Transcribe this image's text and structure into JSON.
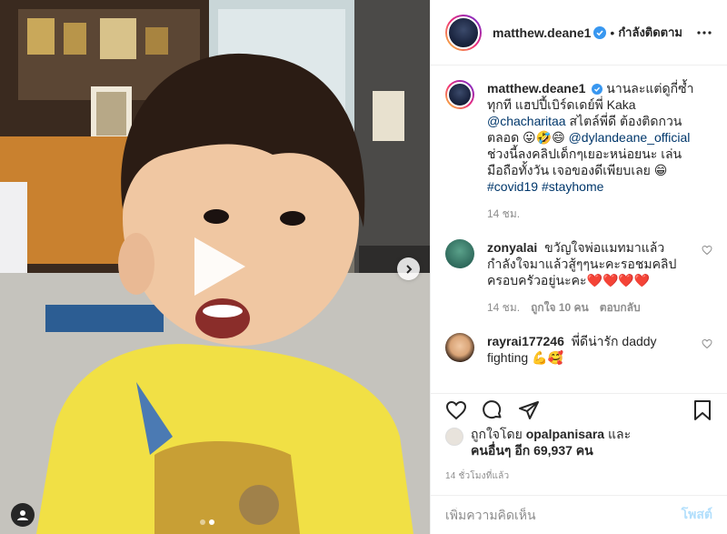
{
  "post": {
    "author": "matthew.deane1",
    "separator": "•",
    "follow_status": "กำลังติดตาม",
    "media": {
      "slide_count": 2,
      "active_slide": 2
    }
  },
  "caption": {
    "username": "matthew.deane1",
    "line1": "นานละแต่ดูกี่ซ้ำทุกที แฮปปี้เบิร์ดเดย์พี่ Kaka",
    "mention1": "@chacharitaa",
    "line2": "สไตล์พี่ดี ต้องติดกวนตลอด 😛🤣😄",
    "mention2": "@dylandeane_official",
    "line3": "ช่วงนี้ลงคลิปเด็กๆเยอะหน่อยนะ เล่นมือถือทั้งวัน เจอของดีเพียบเลย 😁",
    "hashtag1": "#covid19",
    "hashtag2": "#stayhome",
    "time": "14 ชม."
  },
  "comments": [
    {
      "username": "zonyalai",
      "text": "ขวัญใจพ่อแมทมาแล้ว กำลังใจมาแล้วสู้ๆๆนะคะรอชมคลิปครอบครัวอยู่นะคะ❤️❤️❤️❤️",
      "time": "14 ชม.",
      "likes": "ถูกใจ 10 คน",
      "reply": "ตอบกลับ"
    },
    {
      "username": "rayrai177246",
      "text": "พี่ดีน่ารัก daddy fighting 💪🥰"
    }
  ],
  "likes": {
    "prefix": "ถูกใจโดย",
    "first_user": "opalpanisara",
    "connector": "และ",
    "others": "คนอื่นๆ อีก 69,937 คน"
  },
  "timestamp": "14 ชั่วโมงที่แล้ว",
  "add_comment": {
    "placeholder": "เพิ่มความคิดเห็น",
    "post_label": "โพสต์"
  },
  "colors": {
    "verified": "#3897f0",
    "link": "#00376b",
    "muted": "#8e8e8e",
    "post_disabled": "#b2dffc"
  },
  "icons": {
    "play": "play-icon",
    "next": "chevron-right-icon",
    "tag": "user-tag-icon",
    "more": "more-horizontal-icon",
    "like": "heart-icon",
    "comment": "comment-icon",
    "share": "send-icon",
    "save": "bookmark-icon"
  }
}
